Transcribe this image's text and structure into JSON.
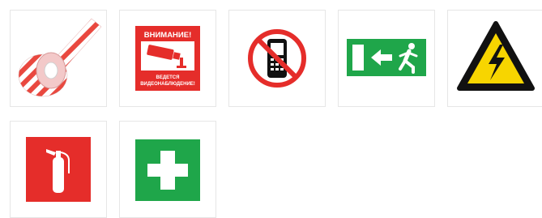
{
  "products": [
    {
      "name": "barrier-tape",
      "icon": "barrier-tape-icon"
    },
    {
      "name": "video-surveillance-sign",
      "icon": "cctv-camera-icon",
      "heading": "ВНИМАНИЕ!",
      "subtext_line1": "ВЕДЕТСЯ",
      "subtext_line2": "ВИДЕОНАБЛЮДЕНИЕ!"
    },
    {
      "name": "no-mobile-phones-sign",
      "icon": "no-phone-icon"
    },
    {
      "name": "emergency-exit-sign",
      "icon": "exit-arrow-icon"
    },
    {
      "name": "high-voltage-sign",
      "icon": "lightning-icon"
    },
    {
      "name": "fire-extinguisher-sign",
      "icon": "fire-extinguisher-icon"
    },
    {
      "name": "first-aid-sign",
      "icon": "first-aid-cross-icon"
    }
  ],
  "colors": {
    "tile_border": "#e6e6e6",
    "sign_red": "#e52d2a",
    "sign_green": "#1fa64a",
    "warning_yellow": "#f7d500",
    "tape_red": "#e9483f"
  }
}
